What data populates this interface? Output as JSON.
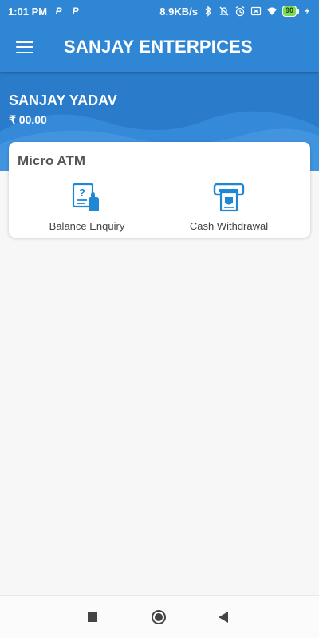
{
  "status_bar": {
    "time": "1:01 PM",
    "left_icons": [
      "P",
      "P"
    ],
    "network_speed": "8.9KB/s",
    "icons": [
      "bluetooth-icon",
      "mute-icon",
      "alarm-icon",
      "sim-off-icon",
      "wifi-icon"
    ],
    "battery": "90"
  },
  "app_bar": {
    "title": "SANJAY ENTERPICES",
    "menu_icon": "hamburger-menu-icon"
  },
  "profile": {
    "name": "SANJAY YADAV",
    "balance": "₹ 00.00"
  },
  "card": {
    "title": "Micro ATM",
    "services": [
      {
        "label": "Balance Enquiry",
        "icon": "balance-enquiry-icon"
      },
      {
        "label": "Cash Withdrawal",
        "icon": "cash-withdrawal-icon"
      }
    ]
  },
  "nav_bar": {
    "buttons": [
      "recents-button",
      "home-button",
      "back-button"
    ]
  },
  "colors": {
    "primary": "#2e86d4",
    "header_dark": "#2a7bc9",
    "icon_blue": "#1e88d6",
    "background": "#f7f7f7"
  }
}
